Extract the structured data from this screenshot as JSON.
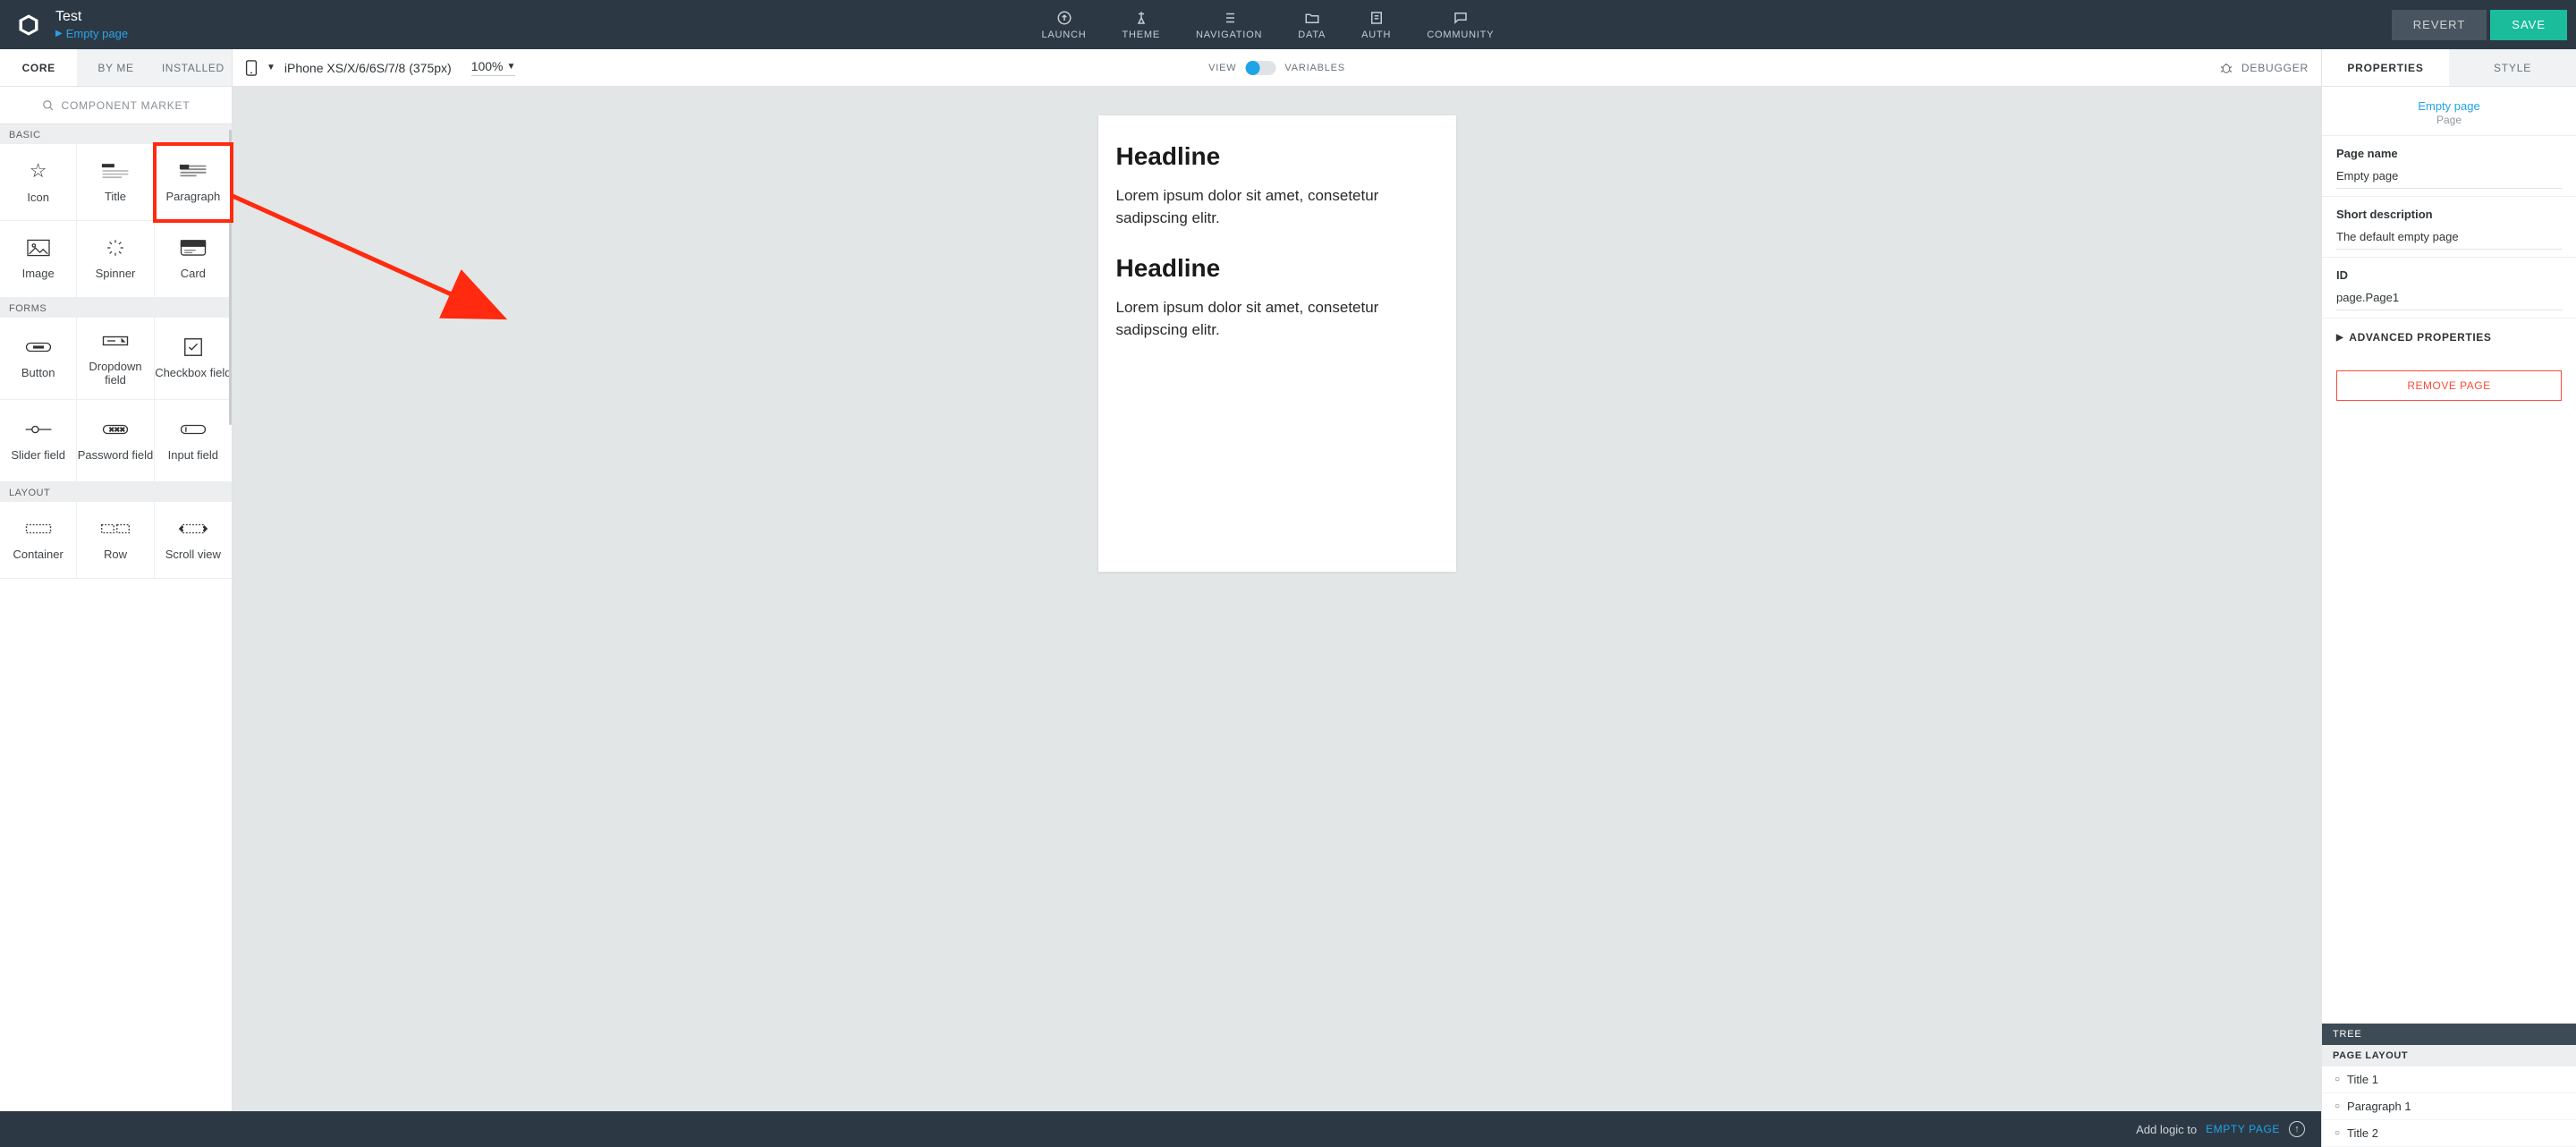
{
  "header": {
    "title": "Test",
    "breadcrumb": "Empty page",
    "nav": [
      {
        "label": "LAUNCH",
        "icon": "upload-icon"
      },
      {
        "label": "THEME",
        "icon": "theme-icon"
      },
      {
        "label": "NAVIGATION",
        "icon": "list-icon"
      },
      {
        "label": "DATA",
        "icon": "folder-icon"
      },
      {
        "label": "AUTH",
        "icon": "auth-icon"
      },
      {
        "label": "COMMUNITY",
        "icon": "chat-icon"
      }
    ],
    "revert": "REVERT",
    "save": "SAVE"
  },
  "left_tabs": [
    "CORE",
    "BY ME",
    "INSTALLED"
  ],
  "left_tabs_active": 0,
  "market": "COMPONENT MARKET",
  "sections": {
    "basic": {
      "title": "BASIC",
      "items": [
        "Icon",
        "Title",
        "Paragraph",
        "Image",
        "Spinner",
        "Card"
      ]
    },
    "forms": {
      "title": "FORMS",
      "items": [
        "Button",
        "Dropdown field",
        "Checkbox field",
        "Slider field",
        "Password field",
        "Input field"
      ]
    },
    "layout": {
      "title": "LAYOUT",
      "items": [
        "Container",
        "Row",
        "Scroll view"
      ]
    }
  },
  "canvas": {
    "device": "iPhone XS/X/6/6S/7/8 (375px)",
    "zoom": "100%",
    "toggle_left": "VIEW",
    "toggle_right": "VARIABLES",
    "debugger": "DEBUGGER",
    "content": {
      "h1a": "Headline",
      "p1": "Lorem ipsum dolor sit amet, consetetur sadipscing elitr.",
      "h1b": "Headline",
      "p2": "Lorem ipsum dolor sit amet, consetetur sadipscing elitr."
    }
  },
  "right_tabs": [
    "PROPERTIES",
    "STYLE"
  ],
  "right_tabs_active": 0,
  "props": {
    "crumb_link": "Empty page",
    "crumb_sub": "Page",
    "page_name_label": "Page name",
    "page_name": "Empty page",
    "desc_label": "Short description",
    "desc": "The default empty page",
    "id_label": "ID",
    "id": "page.Page1",
    "advanced": "ADVANCED PROPERTIES",
    "remove": "REMOVE PAGE"
  },
  "tree": {
    "head": "TREE",
    "sub": "PAGE LAYOUT",
    "items": [
      "Title 1",
      "Paragraph 1",
      "Title 2"
    ]
  },
  "footer": {
    "text": "Add logic to",
    "link": "EMPTY PAGE"
  }
}
